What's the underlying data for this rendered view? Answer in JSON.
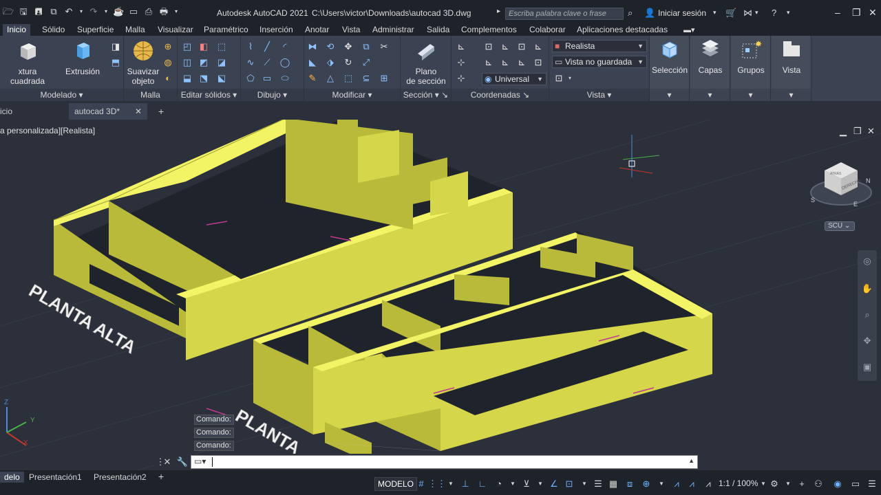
{
  "titlebar": {
    "app": "Autodesk AutoCAD 2021",
    "file": "C:\\Users\\victor\\Downloads\\autocad 3D.dwg",
    "search_placeholder": "Escriba palabra clave o frase",
    "signin": "Iniciar sesión"
  },
  "ribbon_tabs": [
    "Inicio",
    "Sólido",
    "Superficie",
    "Malla",
    "Visualizar",
    "Paramétrico",
    "Inserción",
    "Anotar",
    "Vista",
    "Administrar",
    "Salida",
    "Complementos",
    "Colaborar",
    "Aplicaciones destacadas"
  ],
  "panels": {
    "modelado": {
      "label": "Modelado",
      "btn1": "xtura cuadrada",
      "btn2": "Extrusión"
    },
    "malla": {
      "label": "Malla",
      "btn1_line1": "Suavizar",
      "btn1_line2": "objeto"
    },
    "editar": {
      "label": "Editar sólidos"
    },
    "dibujo": {
      "label": "Dibujo"
    },
    "modificar": {
      "label": "Modificar"
    },
    "seccion": {
      "label": "Sección",
      "btn1_line1": "Plano",
      "btn1_line2": "de sección"
    },
    "coordenadas": {
      "label": "Coordenadas",
      "ucs": "Universal"
    },
    "vista": {
      "label": "Vista",
      "visualstyle": "Realista",
      "namedview": "Vista no guardada"
    },
    "seleccion": {
      "label": "Selección"
    },
    "capas": {
      "label": "Capas"
    },
    "grupos": {
      "label": "Grupos"
    },
    "vistabtn": {
      "label": "Vista"
    }
  },
  "doc_tabs": {
    "start": "icio",
    "current": "autocad 3D*"
  },
  "viewport": {
    "label": "a personalizada][Realista]",
    "scu": "SCU",
    "text_alta": "PLANTA ALTA",
    "text_baja": "PLANTA"
  },
  "viewcube": {
    "face": "DERECHA",
    "face2": "ATRÁS",
    "n": "N",
    "s": "S",
    "e": "E"
  },
  "command": {
    "history": [
      "Comando:",
      "Comando:",
      "Comando:"
    ]
  },
  "status": {
    "tabs": [
      "delo",
      "Presentación1",
      "Presentación2"
    ],
    "model": "MODELO",
    "scale": "1:1 / 100%"
  },
  "colors": {
    "solid_top": "#f3f366",
    "solid_side": "#b9ba3a",
    "solid_front": "#d6d64a",
    "floor": "#1f242c"
  }
}
